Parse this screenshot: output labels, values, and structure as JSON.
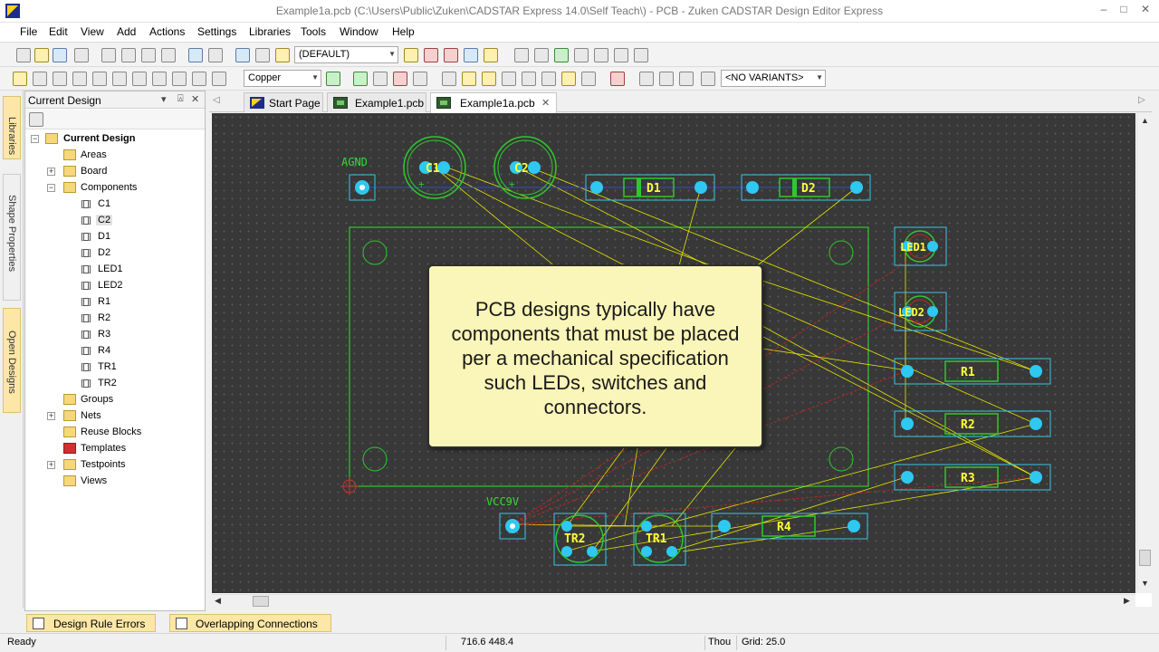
{
  "window": {
    "title": "Example1a.pcb (C:\\Users\\Public\\Zuken\\CADSTAR Express 14.0\\Self Teach\\) - PCB - Zuken CADSTAR Design Editor Express",
    "minimize": "–",
    "maximize": "□",
    "close": "✕"
  },
  "menu": [
    "File",
    "Edit",
    "View",
    "Add",
    "Actions",
    "Settings",
    "Libraries",
    "Tools",
    "Window",
    "Help"
  ],
  "toolbar1": {
    "view_combo": "(DEFAULT)"
  },
  "toolbar2": {
    "layer_combo": "Copper",
    "variants_combo": "<NO VARIANTS>"
  },
  "sidebar_tabs": [
    "Libraries",
    "Shape Properties",
    "Open Designs"
  ],
  "panel": {
    "title": "Current Design",
    "pin": "▾",
    "dock": "⍓",
    "close": "✕"
  },
  "tree": {
    "root": "Current Design",
    "areas": "Areas",
    "board": "Board",
    "components": "Components",
    "component_items": [
      "C1",
      "C2",
      "D1",
      "D2",
      "LED1",
      "LED2",
      "R1",
      "R2",
      "R3",
      "R4",
      "TR1",
      "TR2"
    ],
    "groups": "Groups",
    "nets": "Nets",
    "reuse_blocks": "Reuse Blocks",
    "templates": "Templates",
    "testpoints": "Testpoints",
    "views": "Views"
  },
  "tabs": [
    {
      "label": "Start Page"
    },
    {
      "label": "Example1.pcb"
    },
    {
      "label": "Example1a.pcb",
      "close": "✕"
    }
  ],
  "canvas": {
    "labels": {
      "agnd": "AGND",
      "vcc9v": "VCC9V",
      "c1": "C1",
      "c2": "C2",
      "d1": "D1",
      "d2": "D2",
      "led1": "LED1",
      "led2": "LED2",
      "r1": "R1",
      "r2": "R2",
      "r3": "R3",
      "r4": "R4",
      "tr1": "TR1",
      "tr2": "TR2"
    },
    "callout": "PCB designs typically have components that must be placed per a mechanical specification such LEDs, switches and connectors.",
    "colors": {
      "background": "#383838",
      "board_outline": "#2ec82e",
      "pad": "#2ec8f0",
      "ratsnest": "#e6e600",
      "silkscreen": "#ffff33",
      "component_frame": "#36c6e6"
    }
  },
  "bottom_tabs": [
    "Design Rule Errors",
    "Overlapping Connections"
  ],
  "status": {
    "ready": "Ready",
    "coords": "716.6  448.4",
    "units": "Thou",
    "grid": "Grid: 25.0"
  }
}
